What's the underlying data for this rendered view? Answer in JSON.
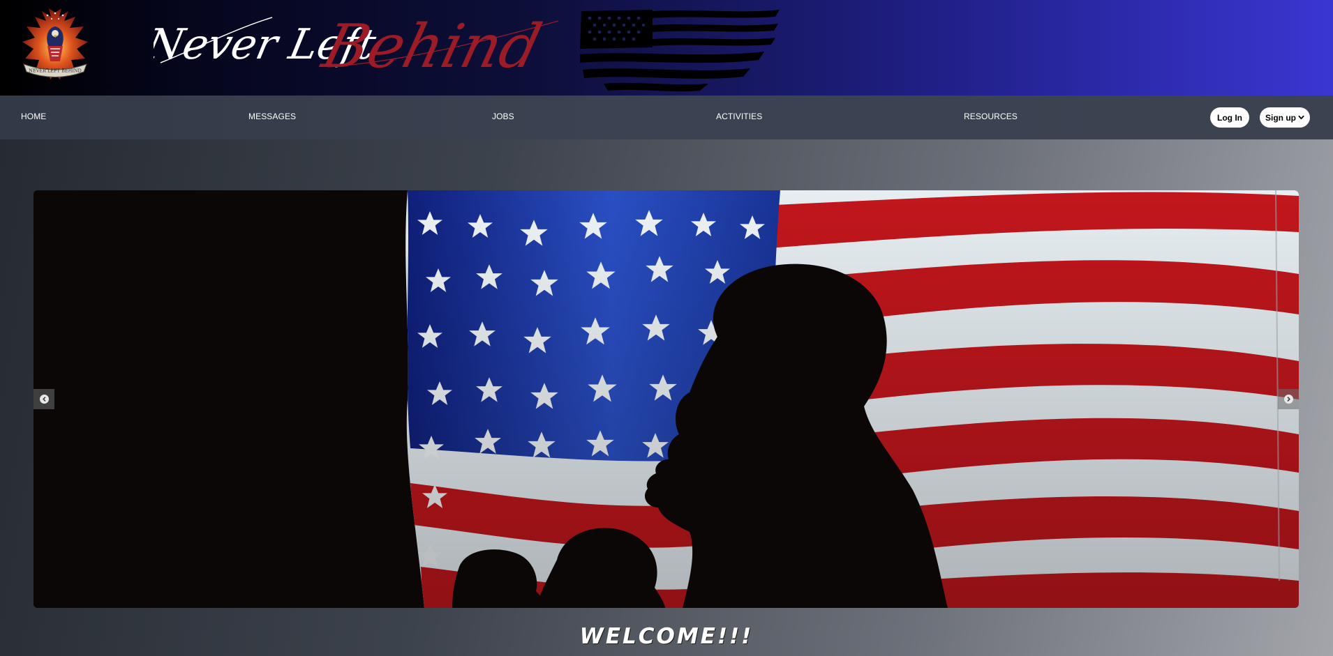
{
  "banner": {
    "brand_first": "Never Left",
    "brand_second": "Behind",
    "logo_ribbon": "NEVER LEFT BEHIND",
    "logo_icon": "phoenix-eagle-emblem",
    "flag_icon": "distressed-us-flag",
    "colors": {
      "brand_first": "#ffffff",
      "brand_second": "#9b1c26"
    }
  },
  "nav": {
    "items": [
      {
        "label": "HOME"
      },
      {
        "label": "MESSAGES"
      },
      {
        "label": "JOBS"
      },
      {
        "label": "ACTIVITIES"
      },
      {
        "label": "RESOURCES"
      }
    ],
    "login_label": "Log In",
    "signup_label": "Sign up",
    "signup_icon": "chevron-down-icon"
  },
  "hero": {
    "image": "silhouettes-before-us-flag",
    "prev_icon": "chevron-left-icon",
    "next_icon": "chevron-right-icon"
  },
  "welcome": {
    "text": "WELCOME!!!"
  }
}
